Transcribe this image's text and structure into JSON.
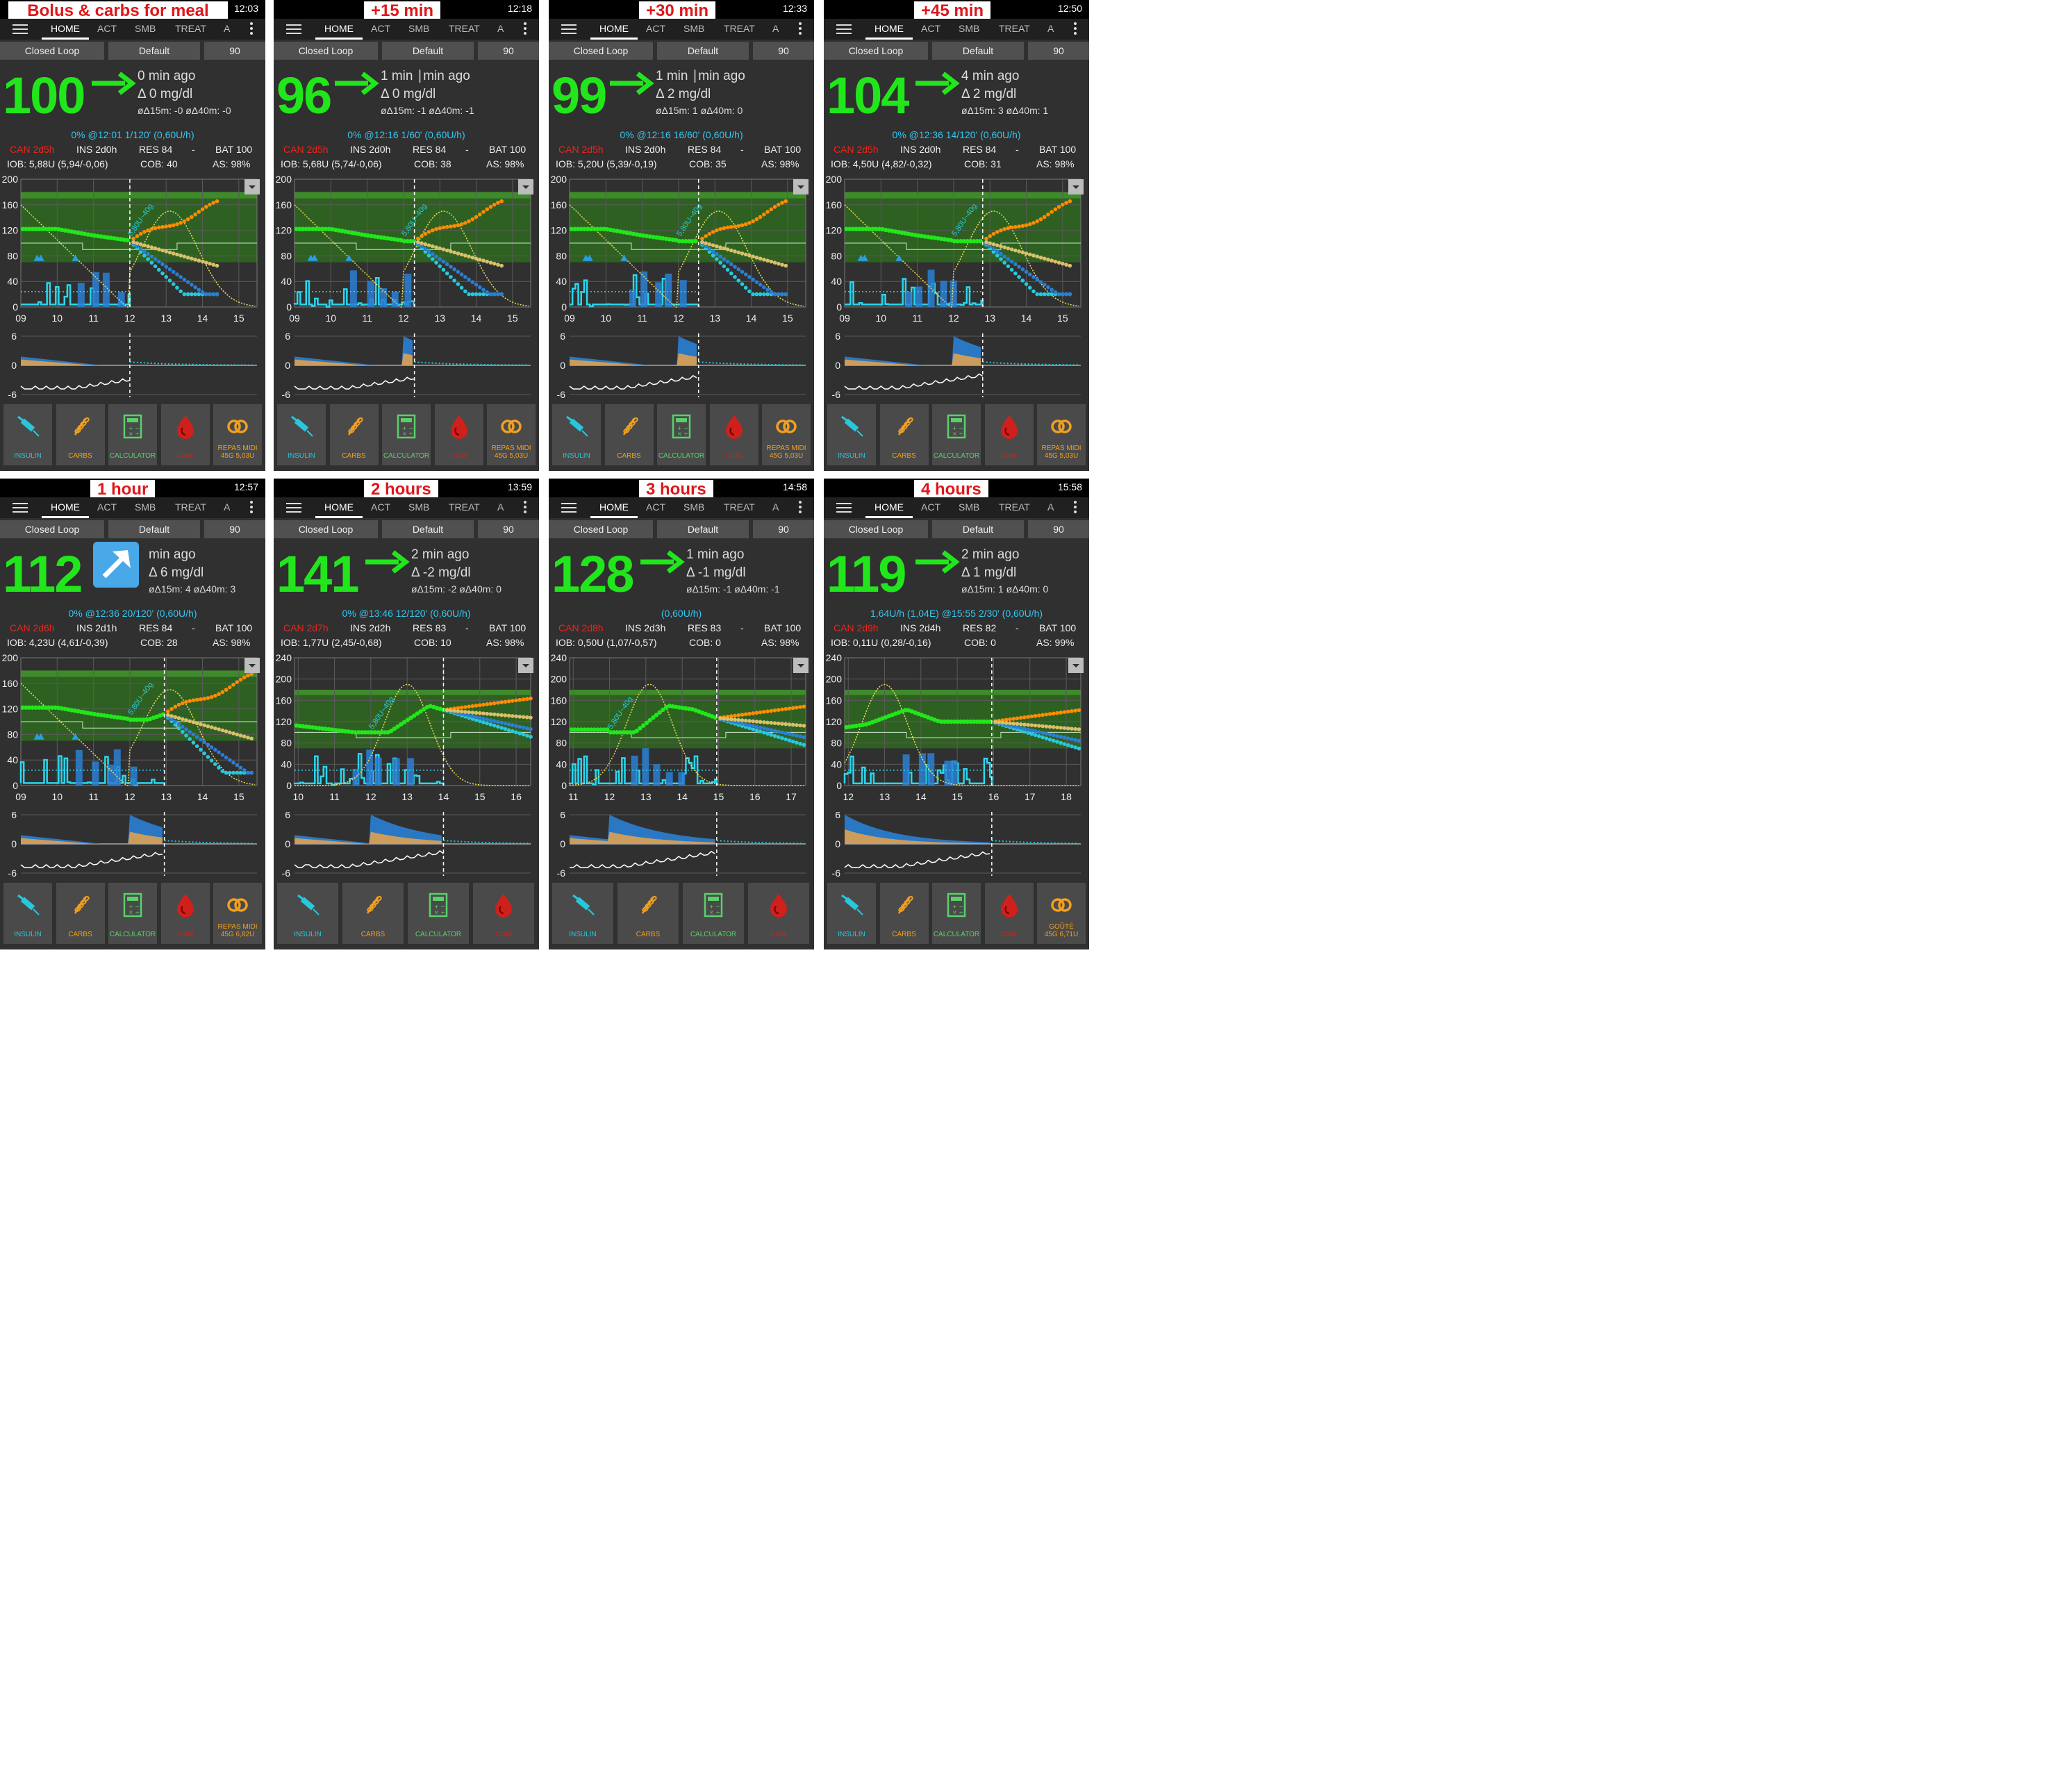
{
  "panels": [
    {
      "label": "Bolus & carbs for meal",
      "time": "12:03",
      "tabs": [
        "HOME",
        "ACT",
        "SMB",
        "TREAT",
        "A"
      ],
      "loop": "Closed Loop",
      "profile": "Default",
      "target": "90",
      "bg": "100",
      "trend": "flat",
      "ago": "0 min ago",
      "delta": "Δ 0 mg/dl",
      "avg": "øΔ15m: -0  øΔ40m: -0",
      "basal": "0% @12:01 1/120' (0,60U/h)",
      "can": "CAN 2d5h",
      "ins": "INS 2d0h",
      "res": "RES 84",
      "dash": "-",
      "bat": "BAT 100",
      "iob": "IOB: 5,88U (5,94/-0,06)",
      "cob": "COB: 40",
      "as": "AS: 98%",
      "yticks": [
        "200",
        "160",
        "120",
        "80",
        "40",
        "0"
      ],
      "xticks": [
        "09",
        "10",
        "11",
        "12",
        "13",
        "14",
        "15"
      ],
      "annot": "5,80U~40g",
      "sticks": [
        "6",
        "0",
        "-6"
      ],
      "buttons": [
        "INSULIN",
        "CARBS",
        "CALCULATOR",
        "CGM",
        "REPAS MIDI\n45G 5,03U"
      ],
      "chart": {
        "xmin": 9,
        "xmax": 15.5,
        "ymax": 200,
        "now": 12.0
      }
    },
    {
      "label": "+15 min",
      "time": "12:18",
      "tabs": [
        "HOME",
        "ACT",
        "SMB",
        "TREAT",
        "A"
      ],
      "loop": "Closed Loop",
      "profile": "Default",
      "target": "90",
      "bg": "96",
      "trend": "flat",
      "ago": "1 min ∣min ago",
      "delta": "Δ 0 mg/dl",
      "avg": "øΔ15m: -1  øΔ40m: -1",
      "basal": "0% @12:16 1/60' (0,60U/h)",
      "can": "CAN 2d5h",
      "ins": "INS 2d0h",
      "res": "RES 84",
      "dash": "-",
      "bat": "BAT 100",
      "iob": "IOB: 5,68U (5,74/-0,06)",
      "cob": "COB: 38",
      "as": "AS: 98%",
      "yticks": [
        "200",
        "160",
        "120",
        "80",
        "40",
        "0"
      ],
      "xticks": [
        "09",
        "10",
        "11",
        "12",
        "13",
        "14",
        "15"
      ],
      "annot": "5,80U~40g",
      "sticks": [
        "6",
        "0",
        "-6"
      ],
      "buttons": [
        "INSULIN",
        "CARBS",
        "CALCULATOR",
        "CGM",
        "REPAS MIDI\n45G 5,03U"
      ],
      "chart": {
        "xmin": 9,
        "xmax": 15.5,
        "ymax": 200,
        "now": 12.3
      }
    },
    {
      "label": "+30 min",
      "time": "12:33",
      "tabs": [
        "HOME",
        "ACT",
        "SMB",
        "TREAT",
        "A"
      ],
      "loop": "Closed Loop",
      "profile": "Default",
      "target": "90",
      "bg": "99",
      "trend": "flat",
      "ago": "1 min ∣min ago",
      "delta": "Δ 2 mg/dl",
      "avg": "øΔ15m: 1  øΔ40m: 0",
      "basal": "0% @12:16 16/60' (0,60U/h)",
      "can": "CAN 2d5h",
      "ins": "INS 2d0h",
      "res": "RES 84",
      "dash": "-",
      "bat": "BAT 100",
      "iob": "IOB: 5,20U (5,39/-0,19)",
      "cob": "COB: 35",
      "as": "AS: 98%",
      "yticks": [
        "200",
        "160",
        "120",
        "80",
        "40",
        "0"
      ],
      "xticks": [
        "09",
        "10",
        "11",
        "12",
        "13",
        "14",
        "15"
      ],
      "annot": "5,80U~40g",
      "sticks": [
        "6",
        "0",
        "-6"
      ],
      "buttons": [
        "INSULIN",
        "CARBS",
        "CALCULATOR",
        "CGM",
        "REPAS MIDI\n45G 5,03U"
      ],
      "chart": {
        "xmin": 9,
        "xmax": 15.5,
        "ymax": 200,
        "now": 12.55
      }
    },
    {
      "label": "+45 min",
      "time": "12:50",
      "tabs": [
        "HOME",
        "ACT",
        "SMB",
        "TREAT",
        "A"
      ],
      "loop": "Closed Loop",
      "profile": "Default",
      "target": "90",
      "bg": "104",
      "trend": "flat",
      "ago": "4 min ago",
      "delta": "Δ 2 mg/dl",
      "avg": "øΔ15m: 3  øΔ40m: 1",
      "basal": "0% @12:36 14/120' (0,60U/h)",
      "can": "CAN 2d5h",
      "ins": "INS 2d0h",
      "res": "RES 84",
      "dash": "-",
      "bat": "BAT 100",
      "iob": "IOB: 4,50U (4,82/-0,32)",
      "cob": "COB: 31",
      "as": "AS: 98%",
      "yticks": [
        "200",
        "160",
        "120",
        "80",
        "40",
        "0"
      ],
      "xticks": [
        "09",
        "10",
        "11",
        "12",
        "13",
        "14",
        "15"
      ],
      "annot": "5,80U~40g",
      "sticks": [
        "6",
        "0",
        "-6"
      ],
      "buttons": [
        "INSULIN",
        "CARBS",
        "CALCULATOR",
        "CGM",
        "REPAS MIDI\n45G 5,03U"
      ],
      "chart": {
        "xmin": 9,
        "xmax": 15.5,
        "ymax": 200,
        "now": 12.8
      }
    },
    {
      "label": "1 hour",
      "time": "12:57",
      "tabs": [
        "HOME",
        "ACT",
        "SMB",
        "TREAT",
        "A"
      ],
      "loop": "Closed Loop",
      "profile": "Default",
      "target": "90",
      "bg": "112",
      "trend": "up",
      "ago": "min ago",
      "delta": "Δ 6 mg/dl",
      "avg": "øΔ15m: 4  øΔ40m: 3",
      "basal": "0% @12:36 20/120' (0,60U/h)",
      "can": "CAN 2d6h",
      "ins": "INS 2d1h",
      "res": "RES 84",
      "dash": "-",
      "bat": "BAT 100",
      "iob": "IOB: 4,23U (4,61/-0,39)",
      "cob": "COB: 28",
      "as": "AS: 98%",
      "yticks": [
        "200",
        "160",
        "120",
        "80",
        "40",
        "0"
      ],
      "xticks": [
        "09",
        "10",
        "11",
        "12",
        "13",
        "14",
        "15"
      ],
      "annot": "5,80U~40g",
      "sticks": [
        "6",
        "0",
        "-6"
      ],
      "buttons": [
        "INSULIN",
        "CARBS",
        "CALCULATOR",
        "CGM",
        "REPAS MIDI\n45G 6,82U"
      ],
      "chart": {
        "xmin": 9,
        "xmax": 15.5,
        "ymax": 200,
        "now": 12.95
      }
    },
    {
      "label": "2 hours",
      "time": "13:59",
      "tabs": [
        "HOME",
        "ACT",
        "SMB",
        "TREAT",
        "A"
      ],
      "loop": "Closed Loop",
      "profile": "Default",
      "target": "90",
      "bg": "141",
      "trend": "flat",
      "ago": "2 min ago",
      "delta": "Δ -2 mg/dl",
      "avg": "øΔ15m: -2  øΔ40m: 0",
      "basal": "0% @13:46 12/120' (0,60U/h)",
      "can": "CAN 2d7h",
      "ins": "INS 2d2h",
      "res": "RES 83",
      "dash": "-",
      "bat": "BAT 100",
      "iob": "IOB: 1,77U (2,45/-0,68)",
      "cob": "COB: 10",
      "as": "AS: 98%",
      "yticks": [
        "240",
        "200",
        "160",
        "120",
        "80",
        "40",
        "0"
      ],
      "xticks": [
        "10",
        "11",
        "12",
        "13",
        "14",
        "15",
        "16"
      ],
      "annot": "5,80U~40g",
      "sticks": [
        "6",
        "0",
        "-6"
      ],
      "buttons": [
        "INSULIN",
        "CARBS",
        "CALCULATOR",
        "CGM"
      ],
      "chart": {
        "xmin": 9.9,
        "xmax": 16.4,
        "ymax": 240,
        "now": 14.0
      }
    },
    {
      "label": "3 hours",
      "time": "14:58",
      "tabs": [
        "HOME",
        "ACT",
        "SMB",
        "TREAT",
        "A"
      ],
      "loop": "Closed Loop",
      "profile": "Default",
      "target": "90",
      "bg": "128",
      "trend": "flat",
      "ago": "1 min ago",
      "delta": "Δ -1 mg/dl",
      "avg": "øΔ15m: -1  øΔ40m: -1",
      "basal": "(0,60U/h)",
      "can": "CAN 2d8h",
      "ins": "INS 2d3h",
      "res": "RES 83",
      "dash": "-",
      "bat": "BAT 100",
      "iob": "IOB: 0,50U (1,07/-0,57)",
      "cob": "COB: 0",
      "as": "AS: 98%",
      "yticks": [
        "240",
        "200",
        "160",
        "120",
        "80",
        "40",
        "0"
      ],
      "xticks": [
        "11",
        "12",
        "13",
        "14",
        "15",
        "16",
        "17"
      ],
      "annot": "5,80U~40g",
      "sticks": [
        "6",
        "0",
        "-6"
      ],
      "buttons": [
        "INSULIN",
        "CARBS",
        "CALCULATOR",
        "CGM"
      ],
      "chart": {
        "xmin": 10.9,
        "xmax": 17.4,
        "ymax": 240,
        "now": 14.95
      }
    },
    {
      "label": "4 hours",
      "time": "15:58",
      "tabs": [
        "HOME",
        "ACT",
        "SMB",
        "TREAT",
        "A"
      ],
      "loop": "Closed Loop",
      "profile": "Default",
      "target": "90",
      "bg": "119",
      "trend": "flat",
      "ago": "2 min ago",
      "delta": "Δ 1 mg/dl",
      "avg": "øΔ15m: 1  øΔ40m: 0",
      "basal": "1,64U/h (1,04E) @15:55 2/30' (0,60U/h)",
      "can": "CAN 2d9h",
      "ins": "INS 2d4h",
      "res": "RES 82",
      "dash": "-",
      "bat": "BAT 100",
      "iob": "IOB: 0,11U (0,28/-0,16)",
      "cob": "COB: 0",
      "as": "AS: 99%",
      "yticks": [
        "240",
        "200",
        "160",
        "120",
        "80",
        "40",
        "0"
      ],
      "xticks": [
        "12",
        "13",
        "14",
        "15",
        "16",
        "17",
        "18"
      ],
      "annot": "",
      "sticks": [
        "6",
        "0",
        "-6"
      ],
      "buttons": [
        "INSULIN",
        "CARBS",
        "CALCULATOR",
        "CGM",
        "GOÛTÉ\n45G 6,71U"
      ],
      "chart": {
        "xmin": 11.9,
        "xmax": 18.4,
        "ymax": 240,
        "now": 15.95
      }
    }
  ],
  "colors": {
    "bg": "#22e61c",
    "basal_text": "#33c7f0",
    "cannula": "#e8261c",
    "target_band": "#2e7d22",
    "prediction_orange": "#ff8c00",
    "prediction_cyan": "#28c8dc",
    "insulin_blue": "#2a7fd4",
    "carb_yellow": "#f0e05a",
    "label_red": "#e0161a"
  },
  "icons": {
    "insulin": "syringe-icon",
    "carbs": "wheat-icon",
    "calculator": "calculator-icon",
    "cgm": "blood-drop-icon",
    "meal": "pretzel-icon"
  }
}
